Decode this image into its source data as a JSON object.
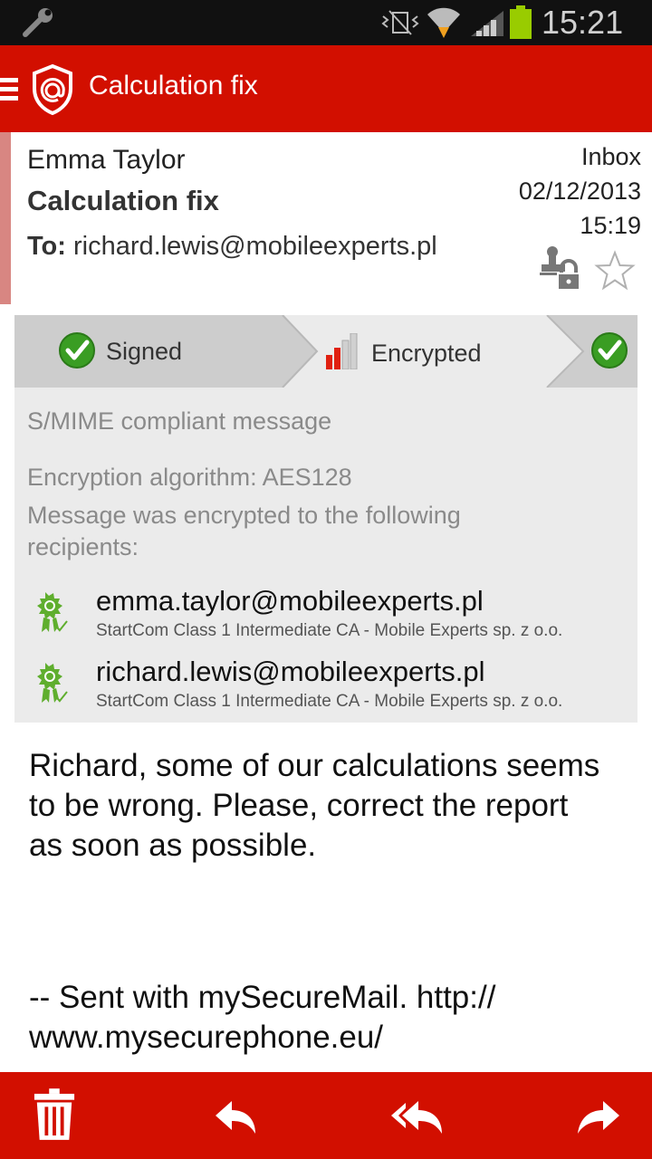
{
  "status_bar": {
    "time": "15:21",
    "icons": [
      "wrench-icon",
      "vibrate-icon",
      "wifi-icon",
      "signal-icon",
      "battery-icon"
    ],
    "battery_color": "#99cc00"
  },
  "action_bar": {
    "title": "Calculation fix",
    "color": "#d20f00",
    "icons": [
      "menu-icon",
      "shield-at-icon"
    ]
  },
  "message": {
    "sender": "Emma Taylor",
    "subject": "Calculation fix",
    "to_label": "To:",
    "to": "richard.lewis@mobileexperts.pl",
    "folder": "Inbox",
    "date": "02/12/2013",
    "time": "15:19",
    "icons": [
      "seal-lock-icon",
      "star-outline-icon"
    ]
  },
  "security_tabs": [
    {
      "label": "Signed",
      "icon": "green-check-icon"
    },
    {
      "label": "Encrypted",
      "icon": "strength-bars-icon"
    },
    {
      "label": "",
      "icon": "green-check-icon"
    }
  ],
  "details": {
    "compliant": "S/MIME compliant message",
    "algorithm": "Encryption algorithm: AES128",
    "encrypted_to": "Message was encrypted to the following recipients:",
    "recipients": [
      {
        "email": "emma.taylor@mobileexperts.pl",
        "issuer": "StartCom Class 1 Intermediate CA - Mobile Experts sp. z o.o."
      },
      {
        "email": "richard.lewis@mobileexperts.pl",
        "issuer": "StartCom Class 1 Intermediate CA - Mobile Experts sp. z o.o."
      }
    ]
  },
  "body": {
    "text": "Richard, some of our calculations seems to be wrong. Please, correct the report as soon as possible.",
    "signature": "-- Sent with mySecureMail. http:// www.mysecurephone.eu/"
  },
  "bottom_bar": {
    "actions": [
      "delete-icon",
      "reply-icon",
      "reply-all-icon",
      "forward-icon"
    ]
  }
}
